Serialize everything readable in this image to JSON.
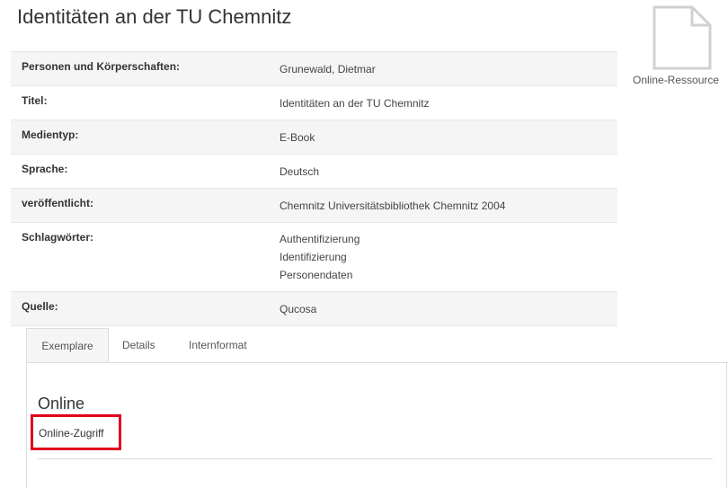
{
  "page": {
    "title": "Identitäten an der TU Chemnitz"
  },
  "record": {
    "rows": [
      {
        "label": "Personen und Körperschaften:",
        "value": "Grunewald, Dietmar"
      },
      {
        "label": "Titel:",
        "value": "Identitäten an der TU Chemnitz"
      },
      {
        "label": "Medientyp:",
        "value": "E-Book"
      },
      {
        "label": "Sprache:",
        "value": "Deutsch"
      },
      {
        "label": "veröffentlicht:",
        "value": "Chemnitz Universitätsbibliothek Chemnitz 2004"
      },
      {
        "label": "Schlagwörter:",
        "values": [
          "Authentifizierung",
          "Identifizierung",
          "Personendaten"
        ]
      },
      {
        "label": "Quelle:",
        "value": "Qucosa"
      }
    ]
  },
  "thumbnail": {
    "icon": "document-icon",
    "caption": "Online-Ressource"
  },
  "tabs": {
    "items": [
      "Exemplare",
      "Details",
      "Internformat"
    ],
    "active": "Exemplare"
  },
  "holdings": {
    "heading": "Online",
    "link_label": "Online-Zugriff",
    "highlight_color": "#e0001b"
  }
}
